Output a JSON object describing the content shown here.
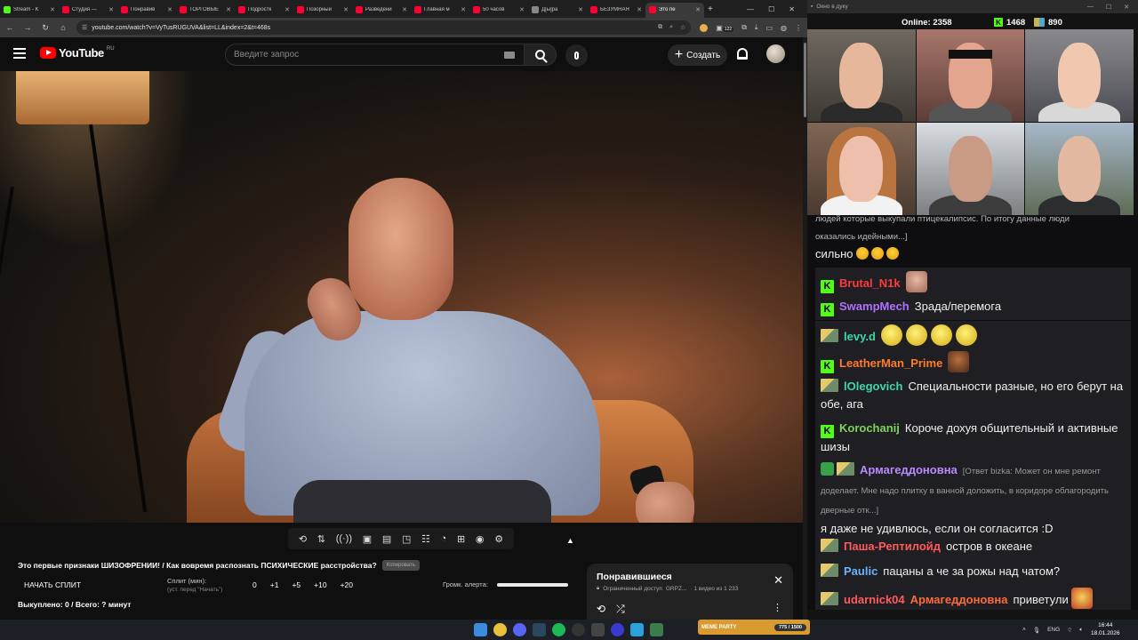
{
  "browser": {
    "tabs": [
      {
        "title": "Stream - K",
        "color": "#53fc18"
      },
      {
        "title": "Студия —",
        "color": "#ff0033"
      },
      {
        "title": "Понравив",
        "color": "#ff0033"
      },
      {
        "title": "ТОРГОВЫЕ",
        "color": "#ff0033"
      },
      {
        "title": "Подростк",
        "color": "#ff0033"
      },
      {
        "title": "Позорный",
        "color": "#ff0033"
      },
      {
        "title": "Разведени",
        "color": "#ff0033"
      },
      {
        "title": "Главная м",
        "color": "#ff0033"
      },
      {
        "title": "50 часов",
        "color": "#ff0033"
      },
      {
        "title": "Д[ы]ра",
        "color": "#888888"
      },
      {
        "title": "БЕЗУМНАЯ",
        "color": "#ff0033"
      },
      {
        "title": "Это пе",
        "color": "#ff0033",
        "active": true
      }
    ],
    "url": "youtube.com/watch?v=VyTusRUGUVA&list=LL&index=2&t=468s",
    "ext_badge": "122"
  },
  "youtube": {
    "logo_text": "YouTube",
    "region": "RU",
    "search_placeholder": "Введите запрос",
    "create_label": "Создать"
  },
  "panel": {
    "video_title": "Это первые признаки ШИЗОФРЕНИИ! / Как вовремя распознать ПСИХИЧЕСКИЕ расстройства?",
    "copy_label": "Копировать",
    "split_start": "НАЧАТЬ СПЛИТ",
    "split_label": "Сплит (мин):",
    "split_hint": "(уст. перед \"Начать\")",
    "split_values": [
      "0",
      "+1",
      "+5",
      "+10",
      "+20"
    ],
    "alert_label": "Громк. алерта:",
    "alert_volume": 1.0,
    "bought": "Выкуплено: 0 / Всего: ? минут"
  },
  "playlist": {
    "title": "Понравившиеся",
    "access": "Ограниченный доступ",
    "owner": "GRPZ...",
    "position": "· 1 видео из 1 233"
  },
  "overlay": {
    "window_title": "Окно в дуку",
    "online_label": "Online:",
    "online_count": "2358",
    "kick_count": "1468",
    "other_count": "890"
  },
  "chat": {
    "partial_lines": [
      "людей которые выкупали птицекалипсис. По итогу данные люди",
      "оказались идейными...]"
    ],
    "partial_text": "сильно",
    "messages": [
      {
        "badge": "k",
        "user": "Brutal_N1k",
        "color": "#ff3b3b",
        "text": "",
        "emotes": [
          "face"
        ]
      },
      {
        "badge": "k",
        "user": "SwampMech",
        "color": "#b070ff",
        "text": "Зрада/перемога"
      },
      {
        "badge": "s",
        "user": "levy.d",
        "color": "#3ed7a8",
        "text": "",
        "emotes": [
          "yellow",
          "yellow",
          "yellow",
          "yellow"
        ]
      },
      {
        "badge": "k",
        "user": "LeatherMan_Prime",
        "color": "#ff7a2e",
        "text": "",
        "emotes": [
          "brown"
        ]
      },
      {
        "badge": "s",
        "user": "lOlegovich",
        "color": "#3ed7a8",
        "text": "Специальности разные, но его берут на обе, ага"
      },
      {
        "badge": "k",
        "user": "Korochanij",
        "color": "#7bd35a",
        "text": "Короче дохуя общительный и активные шизы"
      },
      {
        "badge": "gs",
        "user": "Армагеддоновна",
        "color": "#b58cff",
        "reply": "[Ответ bizka: Может он мне ремонт доделает. Мне надо плитку в ванной доложить, в коридоре облагородить дверные отк...]",
        "text": "я даже не удивлюсь, если он согласится :D"
      },
      {
        "badge": "s",
        "user": "Паша-Рептилойд",
        "color": "#ff5a5a",
        "text": "остров в океане"
      },
      {
        "badge": "s",
        "user": "Paulic",
        "color": "#6db4ff",
        "text": "пацаны а че за рожы над чатом?"
      },
      {
        "badge": "s",
        "user": "udarnick04",
        "color": "#ff5a5a",
        "mention": "Армагеддоновна",
        "text": "приветули",
        "emotes": [
          "red"
        ]
      }
    ]
  },
  "taskbar": {
    "meme_label": "MEME PARTY",
    "meme_progress": "775 / 1500",
    "lang": "ENG",
    "time": "16:44",
    "date": "18.01.2026"
  }
}
